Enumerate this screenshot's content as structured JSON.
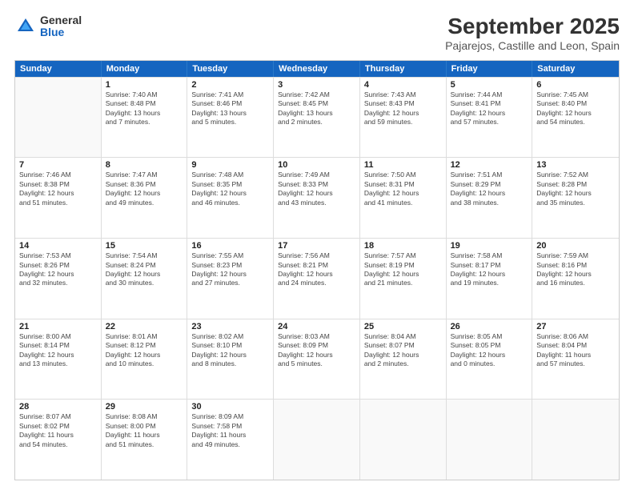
{
  "logo": {
    "general": "General",
    "blue": "Blue"
  },
  "title": "September 2025",
  "subtitle": "Pajarejos, Castille and Leon, Spain",
  "days": [
    "Sunday",
    "Monday",
    "Tuesday",
    "Wednesday",
    "Thursday",
    "Friday",
    "Saturday"
  ],
  "weeks": [
    [
      {
        "day": "",
        "lines": []
      },
      {
        "day": "1",
        "lines": [
          "Sunrise: 7:40 AM",
          "Sunset: 8:48 PM",
          "Daylight: 13 hours",
          "and 7 minutes."
        ]
      },
      {
        "day": "2",
        "lines": [
          "Sunrise: 7:41 AM",
          "Sunset: 8:46 PM",
          "Daylight: 13 hours",
          "and 5 minutes."
        ]
      },
      {
        "day": "3",
        "lines": [
          "Sunrise: 7:42 AM",
          "Sunset: 8:45 PM",
          "Daylight: 13 hours",
          "and 2 minutes."
        ]
      },
      {
        "day": "4",
        "lines": [
          "Sunrise: 7:43 AM",
          "Sunset: 8:43 PM",
          "Daylight: 12 hours",
          "and 59 minutes."
        ]
      },
      {
        "day": "5",
        "lines": [
          "Sunrise: 7:44 AM",
          "Sunset: 8:41 PM",
          "Daylight: 12 hours",
          "and 57 minutes."
        ]
      },
      {
        "day": "6",
        "lines": [
          "Sunrise: 7:45 AM",
          "Sunset: 8:40 PM",
          "Daylight: 12 hours",
          "and 54 minutes."
        ]
      }
    ],
    [
      {
        "day": "7",
        "lines": [
          "Sunrise: 7:46 AM",
          "Sunset: 8:38 PM",
          "Daylight: 12 hours",
          "and 51 minutes."
        ]
      },
      {
        "day": "8",
        "lines": [
          "Sunrise: 7:47 AM",
          "Sunset: 8:36 PM",
          "Daylight: 12 hours",
          "and 49 minutes."
        ]
      },
      {
        "day": "9",
        "lines": [
          "Sunrise: 7:48 AM",
          "Sunset: 8:35 PM",
          "Daylight: 12 hours",
          "and 46 minutes."
        ]
      },
      {
        "day": "10",
        "lines": [
          "Sunrise: 7:49 AM",
          "Sunset: 8:33 PM",
          "Daylight: 12 hours",
          "and 43 minutes."
        ]
      },
      {
        "day": "11",
        "lines": [
          "Sunrise: 7:50 AM",
          "Sunset: 8:31 PM",
          "Daylight: 12 hours",
          "and 41 minutes."
        ]
      },
      {
        "day": "12",
        "lines": [
          "Sunrise: 7:51 AM",
          "Sunset: 8:29 PM",
          "Daylight: 12 hours",
          "and 38 minutes."
        ]
      },
      {
        "day": "13",
        "lines": [
          "Sunrise: 7:52 AM",
          "Sunset: 8:28 PM",
          "Daylight: 12 hours",
          "and 35 minutes."
        ]
      }
    ],
    [
      {
        "day": "14",
        "lines": [
          "Sunrise: 7:53 AM",
          "Sunset: 8:26 PM",
          "Daylight: 12 hours",
          "and 32 minutes."
        ]
      },
      {
        "day": "15",
        "lines": [
          "Sunrise: 7:54 AM",
          "Sunset: 8:24 PM",
          "Daylight: 12 hours",
          "and 30 minutes."
        ]
      },
      {
        "day": "16",
        "lines": [
          "Sunrise: 7:55 AM",
          "Sunset: 8:23 PM",
          "Daylight: 12 hours",
          "and 27 minutes."
        ]
      },
      {
        "day": "17",
        "lines": [
          "Sunrise: 7:56 AM",
          "Sunset: 8:21 PM",
          "Daylight: 12 hours",
          "and 24 minutes."
        ]
      },
      {
        "day": "18",
        "lines": [
          "Sunrise: 7:57 AM",
          "Sunset: 8:19 PM",
          "Daylight: 12 hours",
          "and 21 minutes."
        ]
      },
      {
        "day": "19",
        "lines": [
          "Sunrise: 7:58 AM",
          "Sunset: 8:17 PM",
          "Daylight: 12 hours",
          "and 19 minutes."
        ]
      },
      {
        "day": "20",
        "lines": [
          "Sunrise: 7:59 AM",
          "Sunset: 8:16 PM",
          "Daylight: 12 hours",
          "and 16 minutes."
        ]
      }
    ],
    [
      {
        "day": "21",
        "lines": [
          "Sunrise: 8:00 AM",
          "Sunset: 8:14 PM",
          "Daylight: 12 hours",
          "and 13 minutes."
        ]
      },
      {
        "day": "22",
        "lines": [
          "Sunrise: 8:01 AM",
          "Sunset: 8:12 PM",
          "Daylight: 12 hours",
          "and 10 minutes."
        ]
      },
      {
        "day": "23",
        "lines": [
          "Sunrise: 8:02 AM",
          "Sunset: 8:10 PM",
          "Daylight: 12 hours",
          "and 8 minutes."
        ]
      },
      {
        "day": "24",
        "lines": [
          "Sunrise: 8:03 AM",
          "Sunset: 8:09 PM",
          "Daylight: 12 hours",
          "and 5 minutes."
        ]
      },
      {
        "day": "25",
        "lines": [
          "Sunrise: 8:04 AM",
          "Sunset: 8:07 PM",
          "Daylight: 12 hours",
          "and 2 minutes."
        ]
      },
      {
        "day": "26",
        "lines": [
          "Sunrise: 8:05 AM",
          "Sunset: 8:05 PM",
          "Daylight: 12 hours",
          "and 0 minutes."
        ]
      },
      {
        "day": "27",
        "lines": [
          "Sunrise: 8:06 AM",
          "Sunset: 8:04 PM",
          "Daylight: 11 hours",
          "and 57 minutes."
        ]
      }
    ],
    [
      {
        "day": "28",
        "lines": [
          "Sunrise: 8:07 AM",
          "Sunset: 8:02 PM",
          "Daylight: 11 hours",
          "and 54 minutes."
        ]
      },
      {
        "day": "29",
        "lines": [
          "Sunrise: 8:08 AM",
          "Sunset: 8:00 PM",
          "Daylight: 11 hours",
          "and 51 minutes."
        ]
      },
      {
        "day": "30",
        "lines": [
          "Sunrise: 8:09 AM",
          "Sunset: 7:58 PM",
          "Daylight: 11 hours",
          "and 49 minutes."
        ]
      },
      {
        "day": "",
        "lines": []
      },
      {
        "day": "",
        "lines": []
      },
      {
        "day": "",
        "lines": []
      },
      {
        "day": "",
        "lines": []
      }
    ]
  ]
}
